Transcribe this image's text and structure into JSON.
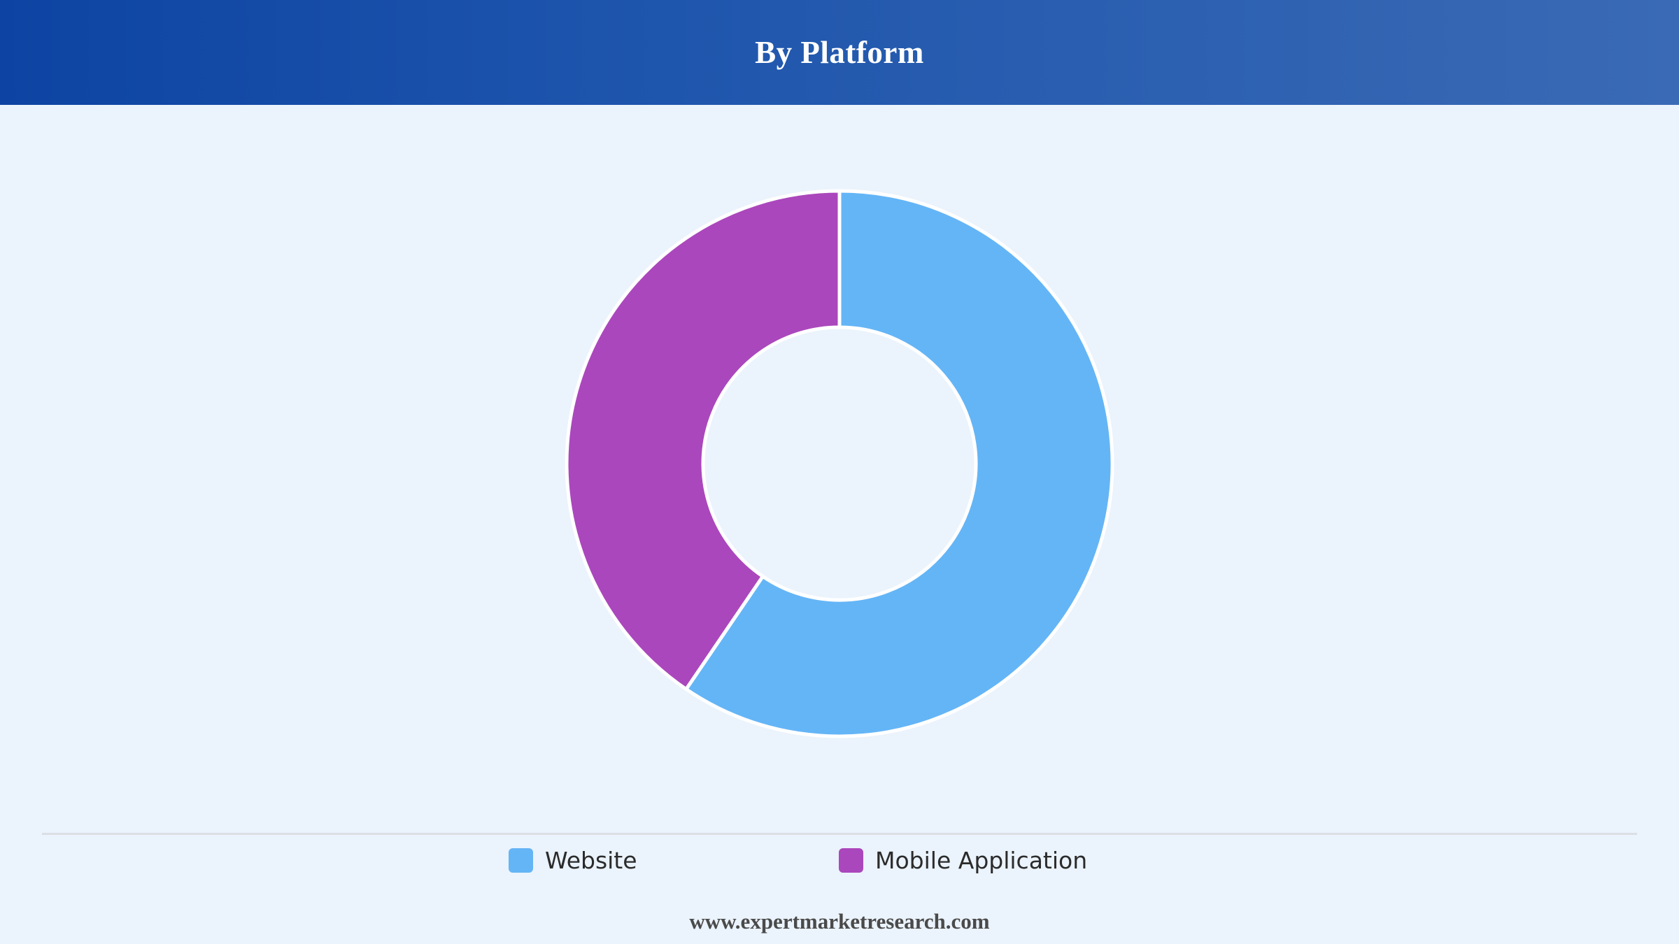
{
  "header": {
    "title": "By Platform"
  },
  "chart_data": {
    "type": "pie",
    "variant": "donut",
    "title": "By Platform",
    "categories": [
      "Website",
      "Mobile Application"
    ],
    "values": [
      59.5,
      40.5
    ],
    "unit": "%",
    "colors": [
      "#64b5f6",
      "#ab47bc"
    ],
    "legend_position": "bottom",
    "start_angle_deg": 0,
    "direction": "clockwise"
  },
  "legend": {
    "items": [
      {
        "label": "Website",
        "color": "#64b5f6"
      },
      {
        "label": "Mobile Application",
        "color": "#ab47bc"
      }
    ]
  },
  "footer": {
    "source": "www.expertmarketresearch.com"
  }
}
